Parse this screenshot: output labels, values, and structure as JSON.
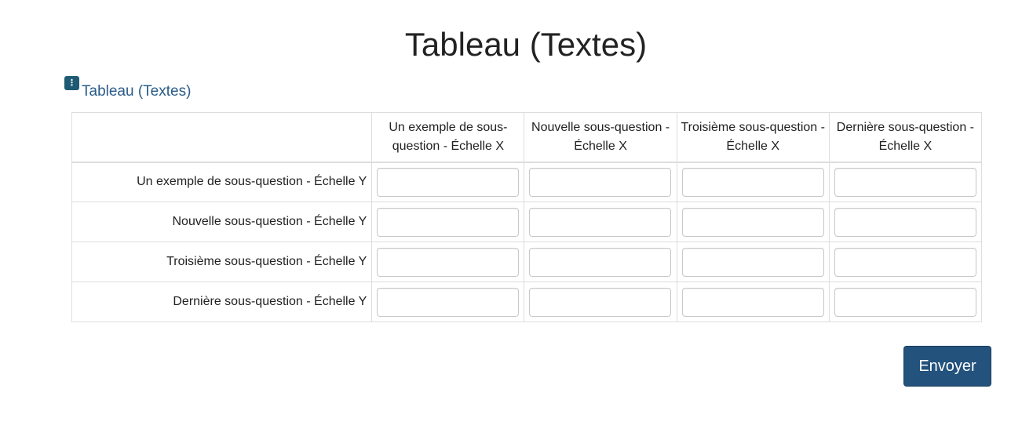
{
  "page": {
    "title": "Tableau (Textes)"
  },
  "question": {
    "icon": "info-icon",
    "label": "Tableau (Textes)"
  },
  "matrix": {
    "columns": [
      "Un exemple de sous-question - Échelle X",
      "Nouvelle sous-question - Échelle X",
      "Troisième sous-question - Échelle X",
      "Dernière sous-question - Échelle X"
    ],
    "rows": [
      {
        "label": "Un exemple de sous-question - Échelle Y",
        "values": [
          "",
          "",
          "",
          ""
        ]
      },
      {
        "label": "Nouvelle sous-question - Échelle Y",
        "values": [
          "",
          "",
          "",
          ""
        ]
      },
      {
        "label": "Troisième sous-question - Échelle Y",
        "values": [
          "",
          "",
          "",
          ""
        ]
      },
      {
        "label": "Dernière sous-question - Échelle Y",
        "values": [
          "",
          "",
          "",
          ""
        ]
      }
    ]
  },
  "actions": {
    "submit_label": "Envoyer"
  },
  "colors": {
    "accent": "#23527c",
    "question_label": "#2a5c8a",
    "icon_bg": "#1e5a74"
  }
}
